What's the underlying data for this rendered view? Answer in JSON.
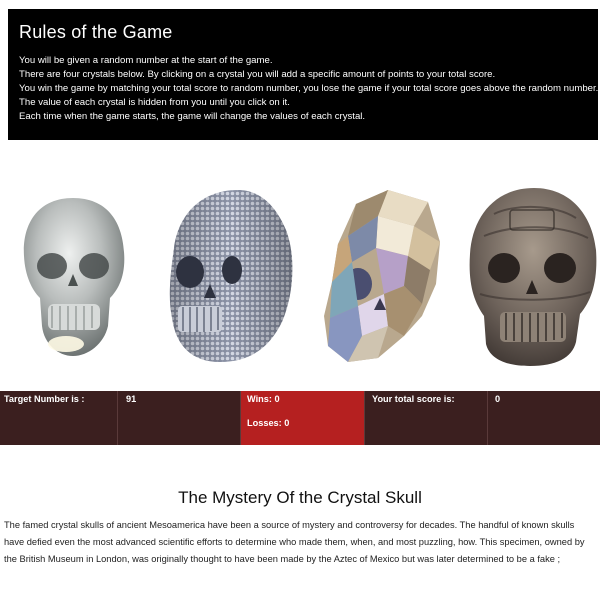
{
  "rules": {
    "title": "Rules of the Game",
    "lines": [
      "You will be given a random number at the start of the game.",
      "There are four crystals below. By clicking on a crystal you will add a specific amount of points to your total score.",
      "You win the game by matching your total score to random number, you lose the game if your total score goes above the random number.",
      "The value of each crystal is hidden from you until you click on it.",
      "Each time when the game starts, the game will change the values of each crystal."
    ]
  },
  "crystals": [
    {
      "name": "clear-quartz-skull",
      "color": "#c9cccc"
    },
    {
      "name": "rhinestone-skull",
      "color": "#a7adbd"
    },
    {
      "name": "faceted-crystal-skull",
      "color": "#cdb89a"
    },
    {
      "name": "bronze-aztec-skull",
      "color": "#7a6e66"
    }
  ],
  "stats": {
    "target_label": "Target Number is :",
    "target_value": "91",
    "wins_label": "Wins: 0",
    "losses_label": "Losses: 0",
    "score_label": "Your total score is:",
    "score_value": "0"
  },
  "colors": {
    "stats_bg": "#3b1f1f",
    "wins_bg": "#b52020",
    "rules_bg": "#000000"
  },
  "article": {
    "title": "The Mystery Of the Crystal Skull",
    "body": "The famed crystal skulls of ancient Mesoamerica have been a source of mystery and controversy for decades. The handful of known skulls have defied even the most advanced scientific efforts to determine who made them, when, and most puzzling, how. This specimen, owned by the British Museum in London, was originally thought to have been made by the Aztec of Mexico but was later determined to be a fake ;"
  }
}
